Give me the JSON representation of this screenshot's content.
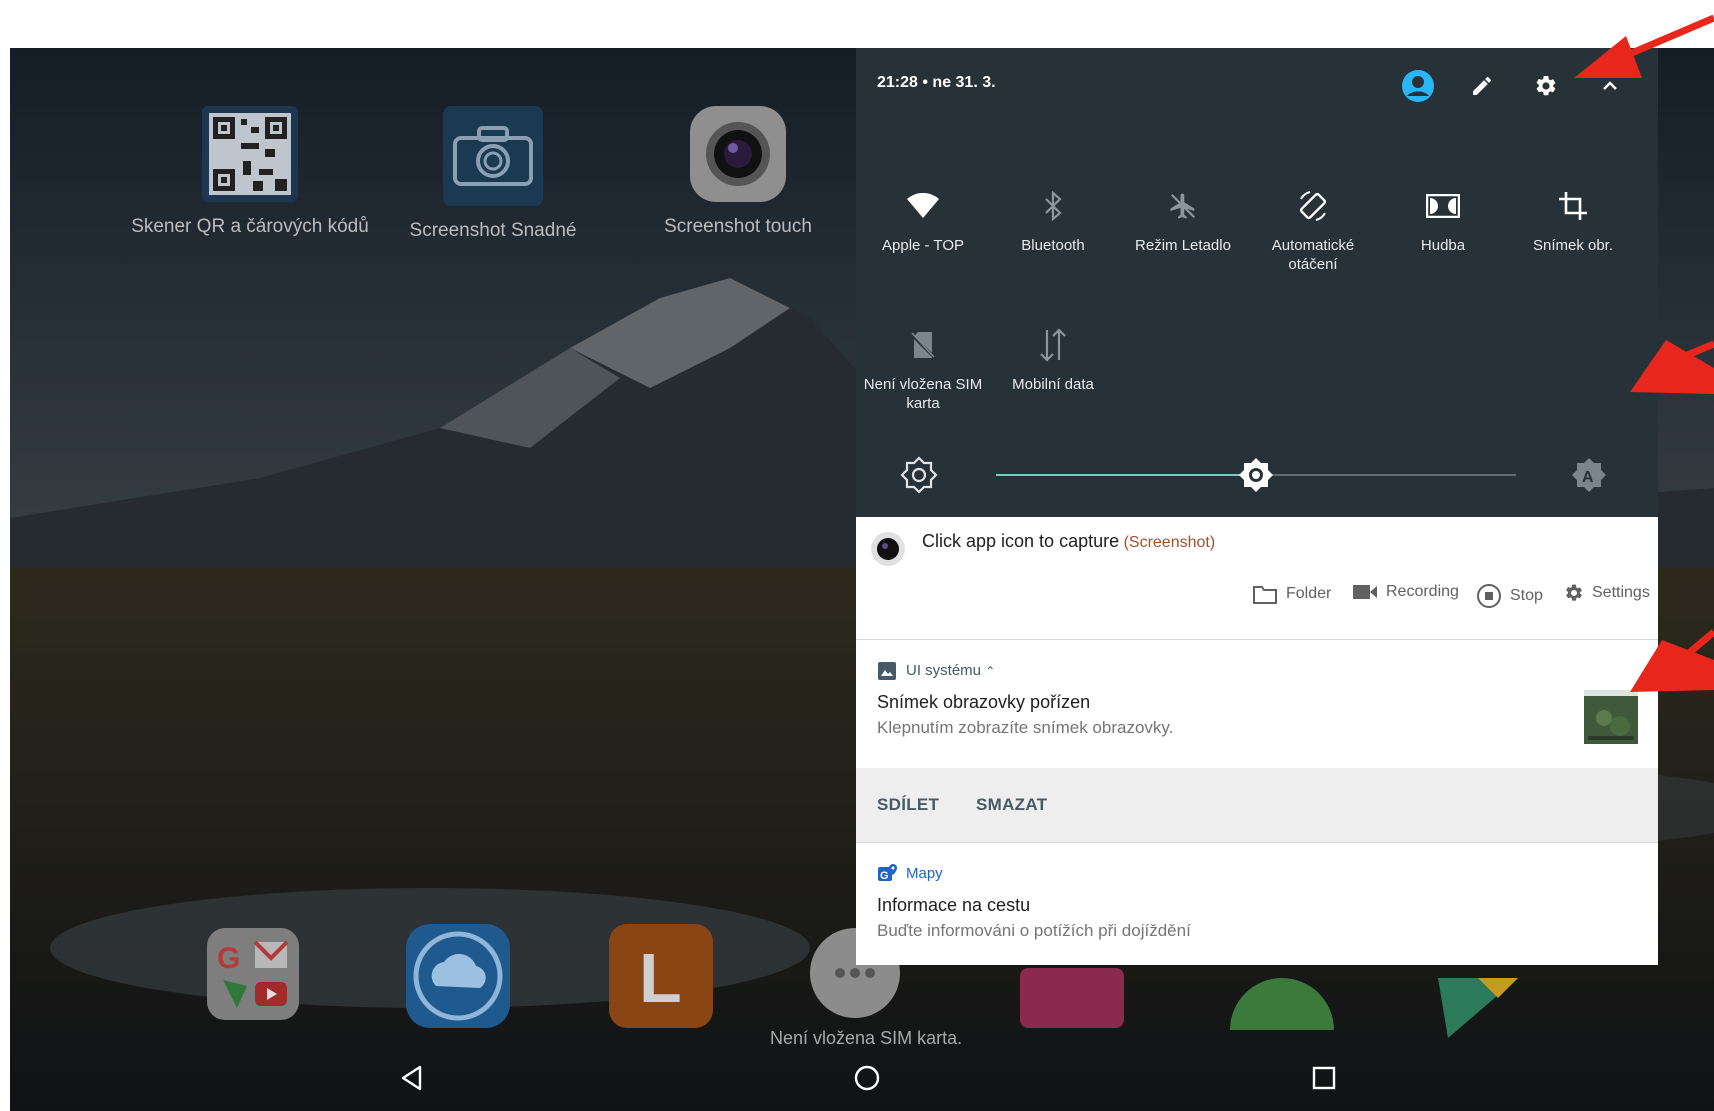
{
  "home": {
    "apps": [
      {
        "label": "Skener QR a čárových kódů",
        "icon": "qr-code-icon"
      },
      {
        "label": "Screenshot Snadné",
        "icon": "camera-icon"
      },
      {
        "label": "Screenshot touch",
        "icon": "camera-lens-icon"
      }
    ],
    "dock": [
      "google-apps-folder-icon",
      "cloud-sync-icon",
      "l-app-icon",
      "apps-drawer-icon",
      "media-app-icon",
      "chrome-icon",
      "play-store-icon"
    ],
    "sim_status": "Není vložena SIM karta."
  },
  "quick_settings": {
    "time_date": "21:28 • ne 31. 3.",
    "header_icons": [
      "account-icon",
      "edit-icon",
      "settings-icon",
      "collapse-icon"
    ],
    "tiles": [
      {
        "label": "Apple - TOP",
        "icon": "wifi-icon"
      },
      {
        "label": "Bluetooth",
        "icon": "bluetooth-icon"
      },
      {
        "label": "Režim Letadlo",
        "icon": "airplane-icon"
      },
      {
        "label": "Automatické otáčení",
        "icon": "auto-rotate-icon"
      },
      {
        "label": "Hudba",
        "icon": "dolby-icon"
      },
      {
        "label": "Snímek obr.",
        "icon": "crop-icon"
      },
      {
        "label": "Není vložena SIM karta",
        "icon": "no-sim-icon"
      },
      {
        "label": "Mobilní data",
        "icon": "mobile-data-icon"
      }
    ],
    "brightness_level": 0.5
  },
  "notifications": {
    "screenshot_app": {
      "title": "Click app icon to capture",
      "app_name": "(Screenshot)",
      "actions": [
        "Folder",
        "Recording",
        "Stop",
        "Settings"
      ]
    },
    "system_ui": {
      "app": "UI systému",
      "title": "Snímek obrazovky pořízen",
      "text": "Klepnutím zobrazíte snímek obrazovky.",
      "buttons": [
        "SDÍLET",
        "SMAZAT"
      ]
    },
    "maps": {
      "app": "Mapy",
      "title": "Informace na cestu",
      "text": "Buďte informováni o potížích při dojíždění"
    }
  },
  "colors": {
    "annotation_arrow": "#e8261c",
    "qs_background": "#263238",
    "accent": "#29b6f6"
  }
}
